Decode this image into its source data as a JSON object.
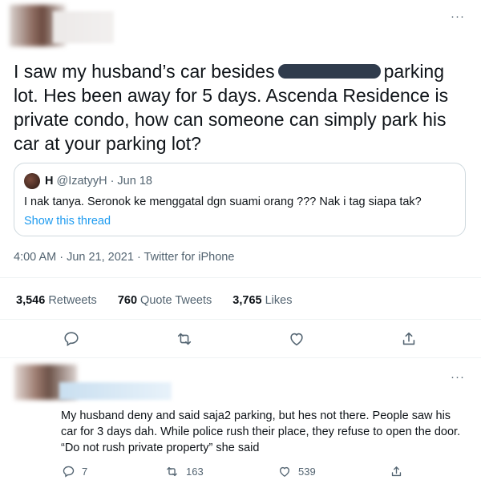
{
  "tweet": {
    "text_part1": "I saw my husband’s car besides",
    "text_part2": "parking lot. Hes been away for 5 days. Ascenda Residence is private condo, how can someone can simply park his car at your parking lot?",
    "timestamp": "4:00 AM · Jun 21, 2021 · Twitter for iPhone",
    "more": "···"
  },
  "quote": {
    "name": "H",
    "handle": "@IzatyyH · Jun 18",
    "text": "I nak tanya. Seronok ke menggatal dgn suami orang ??? Nak i tag siapa tak?",
    "show_thread": "Show this thread"
  },
  "stats": {
    "retweets_count": "3,546",
    "retweets_label": "Retweets",
    "quotes_count": "760",
    "quotes_label": "Quote Tweets",
    "likes_count": "3,765",
    "likes_label": "Likes"
  },
  "reply": {
    "more": "···",
    "text": "My husband deny and said saja2 parking, but hes not there. People saw his car for 3 days dah. While police rush their place, they refuse to open the door. “Do not rush private property” she said",
    "reply_count": "7",
    "retweet_count": "163",
    "like_count": "539"
  },
  "icons": {
    "reply": "comment-icon",
    "retweet": "retweet-icon",
    "like": "heart-icon",
    "share": "share-icon"
  },
  "colors": {
    "link": "#1d9bf0",
    "muted": "#536471",
    "text": "#0f1419"
  }
}
